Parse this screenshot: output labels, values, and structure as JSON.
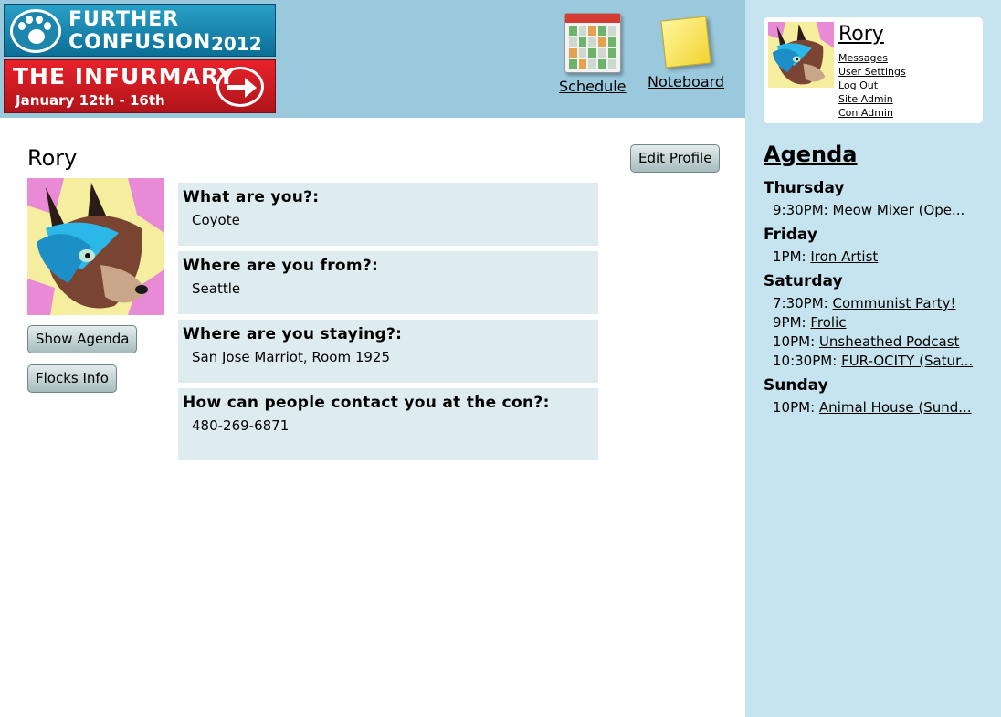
{
  "header": {
    "logo": {
      "title_line1": "FURTHER",
      "title_line2": "CONFUSION",
      "year": "2012",
      "subtitle": "THE INFURMARY",
      "dates": "January 12th - 16th"
    },
    "nav": [
      {
        "label": "Schedule",
        "icon": "calendar-icon"
      },
      {
        "label": "Noteboard",
        "icon": "sticky-note-icon"
      }
    ]
  },
  "profile": {
    "name": "Rory",
    "edit_button": "Edit Profile",
    "show_agenda_button": "Show Agenda",
    "flocks_button": "Flocks Info",
    "questions": [
      {
        "q": "What are you?:",
        "a": "Coyote"
      },
      {
        "q": "Where are you from?:",
        "a": "Seattle"
      },
      {
        "q": "Where are you staying?:",
        "a": "San Jose Marriot, Room 1925"
      },
      {
        "q": "How can people contact you at the con?:",
        "a": "480-269-6871"
      }
    ]
  },
  "user": {
    "name": "Rory",
    "links": [
      "Messages",
      "User Settings",
      "Log Out",
      "Site Admin",
      "Con Admin"
    ]
  },
  "agenda": {
    "title": "Agenda",
    "days": [
      {
        "day": "Thursday",
        "events": [
          {
            "time": "9:30PM:",
            "title": "Meow Mixer (Ope..."
          }
        ]
      },
      {
        "day": "Friday",
        "events": [
          {
            "time": "1PM:",
            "title": "Iron Artist"
          }
        ]
      },
      {
        "day": "Saturday",
        "events": [
          {
            "time": "7:30PM:",
            "title": "Communist Party!"
          },
          {
            "time": "9PM:",
            "title": "Frolic"
          },
          {
            "time": "10PM:",
            "title": "Unsheathed Podcast"
          },
          {
            "time": "10:30PM:",
            "title": "FUR-OCITY (Satur..."
          }
        ]
      },
      {
        "day": "Sunday",
        "events": [
          {
            "time": "10PM:",
            "title": "Animal House (Sund..."
          }
        ]
      }
    ]
  },
  "colors": {
    "header_bg": "#9ac8dc",
    "sidebar_bg": "#c6e4ef",
    "qa_bg": "#deecf0",
    "logo_blue": "#1c86ad",
    "logo_red": "#d31b22"
  }
}
